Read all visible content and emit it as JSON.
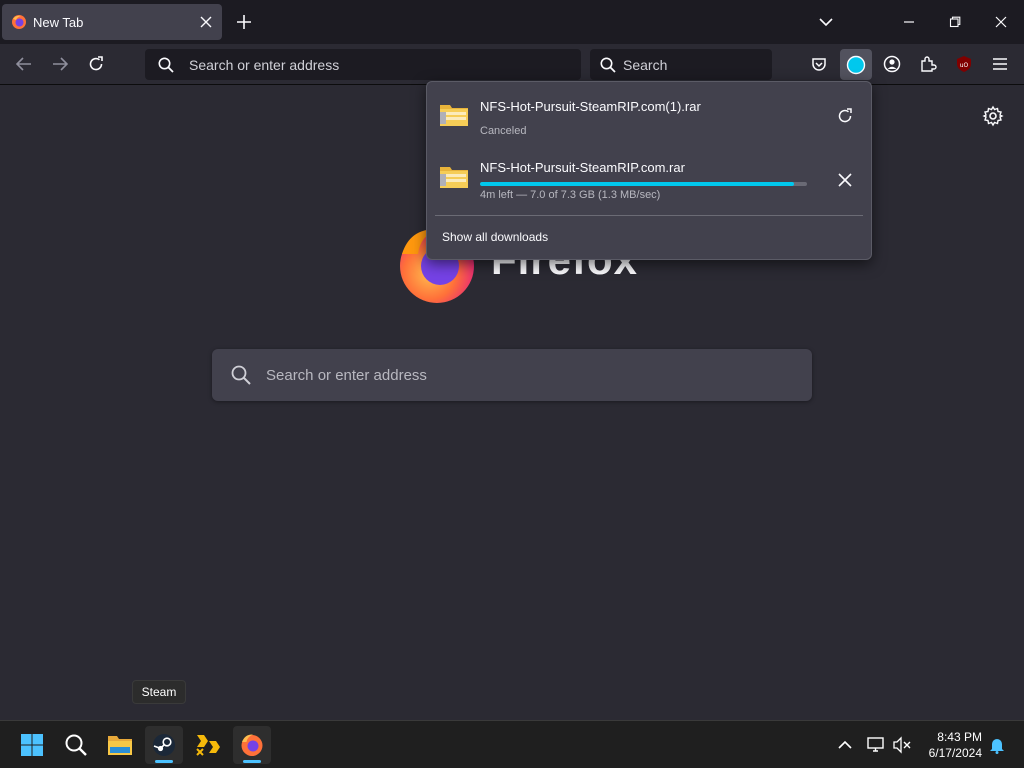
{
  "tabs": [
    {
      "title": "New Tab",
      "icon": "firefox-icon"
    }
  ],
  "toolbar": {
    "address_placeholder": "Search or enter address",
    "search_placeholder": "Search"
  },
  "page": {
    "brand_wordmark": "Firefox",
    "search_placeholder": "Search or enter address"
  },
  "downloads": {
    "items": [
      {
        "filename": "NFS-Hot-Pursuit-SteamRIP.com(1).rar",
        "status": "Canceled",
        "action": "retry"
      },
      {
        "filename": "NFS-Hot-Pursuit-SteamRIP.com.rar",
        "status": "4m left — 7.0 of 7.3 GB (1.3 MB/sec)",
        "progress": 0.96,
        "action": "cancel"
      }
    ],
    "show_all_label": "Show all downloads"
  },
  "taskbar": {
    "tooltip": "Steam",
    "apps": [
      "start",
      "search",
      "file-explorer",
      "steam",
      "app-yellow",
      "firefox"
    ],
    "time": "8:43 PM",
    "date": "6/17/2024"
  },
  "colors": {
    "accent": "#00c8ed",
    "tab_background": "#42414d",
    "chrome_background": "#1c1b22",
    "page_background": "#2b2a33"
  }
}
